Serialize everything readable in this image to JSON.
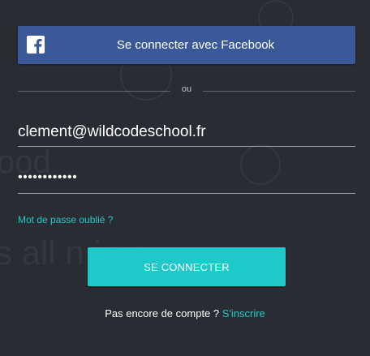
{
  "background": {
    "headline_fragment_1": "ood",
    "headline_fragment_2": "s all n     i    ns."
  },
  "facebook_button": {
    "label": "Se connecter avec Facebook",
    "icon": "facebook-icon",
    "color": "#3b5998"
  },
  "divider": {
    "text": "ou"
  },
  "email_field": {
    "value": "clement@wildcodeschool.fr"
  },
  "password_field": {
    "value": "••••••••••••"
  },
  "forgot_password": {
    "label": "Mot de passe oublié ?"
  },
  "login_button": {
    "label": "SE CONNECTER",
    "color": "#20c9c9"
  },
  "signup": {
    "prompt": "Pas encore de compte ? ",
    "link_label": "S'inscrire"
  },
  "colors": {
    "background": "#2a2c33",
    "accent": "#20c9c9"
  }
}
